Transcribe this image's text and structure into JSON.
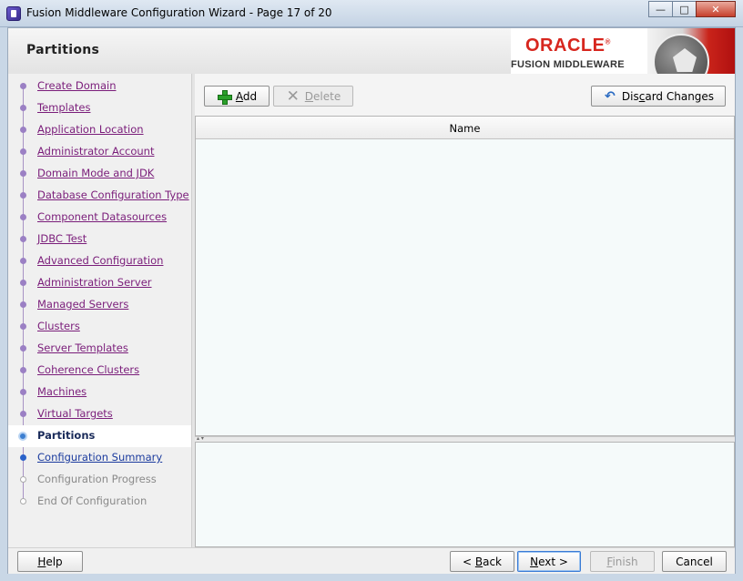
{
  "window": {
    "title": "Fusion Middleware Configuration Wizard - Page 17 of 20",
    "controls": {
      "minimize": "—",
      "maximize": "□",
      "close": "✕"
    }
  },
  "header": {
    "title": "Partitions",
    "brand_top": "ORACLE",
    "brand_bottom": "FUSION MIDDLEWARE",
    "brand_registered": "®"
  },
  "nav": {
    "items": [
      {
        "label": "Create Domain",
        "state": "visited"
      },
      {
        "label": "Templates",
        "state": "visited"
      },
      {
        "label": "Application Location",
        "state": "visited"
      },
      {
        "label": "Administrator Account",
        "state": "visited"
      },
      {
        "label": "Domain Mode and JDK",
        "state": "visited"
      },
      {
        "label": "Database Configuration Type",
        "state": "visited"
      },
      {
        "label": "Component Datasources",
        "state": "visited"
      },
      {
        "label": "JDBC Test",
        "state": "visited"
      },
      {
        "label": "Advanced Configuration",
        "state": "visited"
      },
      {
        "label": "Administration Server",
        "state": "visited"
      },
      {
        "label": "Managed Servers",
        "state": "visited"
      },
      {
        "label": "Clusters",
        "state": "visited"
      },
      {
        "label": "Server Templates",
        "state": "visited"
      },
      {
        "label": "Coherence Clusters",
        "state": "visited"
      },
      {
        "label": "Machines",
        "state": "visited"
      },
      {
        "label": "Virtual Targets",
        "state": "visited"
      },
      {
        "label": "Partitions",
        "state": "current"
      },
      {
        "label": "Configuration Summary",
        "state": "next"
      },
      {
        "label": "Configuration Progress",
        "state": "disabled"
      },
      {
        "label": "End Of Configuration",
        "state": "disabled"
      }
    ]
  },
  "toolbar": {
    "add_pre": "",
    "add_key": "A",
    "add_post": "dd",
    "delete_pre": "",
    "delete_key": "D",
    "delete_post": "elete",
    "discard_pre": "Dis",
    "discard_key": "c",
    "discard_post": "ard Changes"
  },
  "table": {
    "columns": [
      "Name"
    ],
    "rows": []
  },
  "divider_glyph": "▴ ▾",
  "footer": {
    "help_key": "H",
    "help_post": "elp",
    "back_pre": "< ",
    "back_key": "B",
    "back_post": "ack",
    "next_key": "N",
    "next_post": "ext >",
    "finish_key": "F",
    "finish_post": "inish",
    "cancel": "Cancel"
  },
  "icons": {
    "add": "plus-icon",
    "delete": "x-icon",
    "discard": "undo-icon"
  }
}
